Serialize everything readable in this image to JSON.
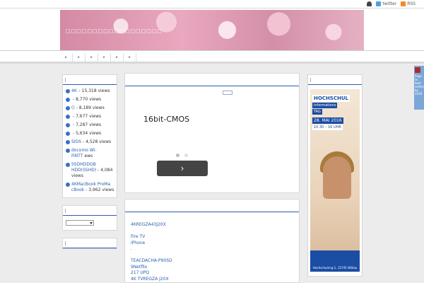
{
  "toplinks": {
    "twitter": "twitter",
    "rss": "RSS"
  },
  "site_title": "□□□□□□□□□□□□□□□□□□",
  "nav": [
    "▸",
    "▸",
    "▸",
    "▸",
    "▸",
    "▸"
  ],
  "popular": [
    {
      "link": "4K",
      "views": "– 15,318 views"
    },
    {
      "link": "",
      "views": "- 8,770 views"
    },
    {
      "link": "()",
      "views": "- 8,189 views"
    },
    {
      "link": "",
      "views": "- 7,677 views"
    },
    {
      "link": "",
      "views": "- 7,287 views"
    },
    {
      "link": "",
      "views": "- 5,634 views"
    },
    {
      "link": "SIDS",
      "views": "- 4,528 views"
    },
    {
      "link": "docomo Wi-FiNTT",
      "views": "ews"
    },
    {
      "link": "SSDHDDGB HDD(SSHD)",
      "views": "- 4,084 views"
    },
    {
      "link": "4KMacBook ProMa cBook",
      "views": "- 3,962 views"
    }
  ],
  "ad": {
    "title": "16bit-CMOS",
    "button": "›"
  },
  "center_links": [
    "4KREGZA43J20X",
    "",
    "Fire TV",
    "iPhone",
    ".",
    "",
    "TEACDACHA-P90SD",
    "9Netflix",
    "217 UPQ",
    "4K TVREGZA J20X"
  ],
  "right_ad": {
    "title": "HOCHSCHUL",
    "sub1": "informations",
    "sub2": "TAG",
    "date": "28. MAI 2016",
    "time": "10.30 – 16 UHR",
    "addr": "Hochschulring 1, 15745 Wildau"
  },
  "side_tab": "Page to best sellers by 2016"
}
